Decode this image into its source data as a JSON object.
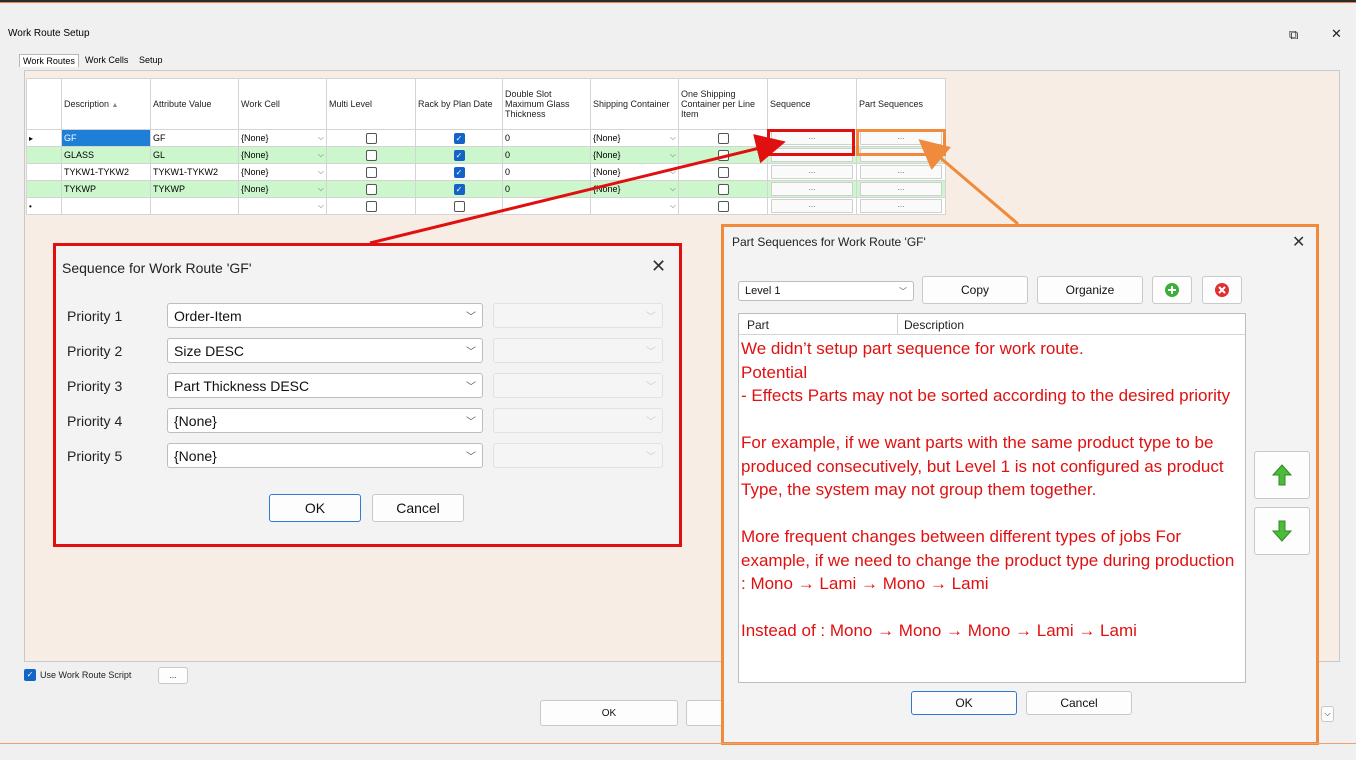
{
  "window": {
    "title": "Work Route Setup",
    "restore_glyph": "⧉",
    "close_glyph": "✕"
  },
  "tabs": [
    "Work Routes",
    "Work Cells",
    "Setup"
  ],
  "grid": {
    "headers": [
      "Description",
      "Attribute Value",
      "Work Cell",
      "Multi Level",
      "Rack by Plan Date",
      "Double Slot Maximum Glass Thickness",
      "Shipping Container",
      "One Shipping Container per Line Item",
      "Sequence",
      "Part Sequences"
    ],
    "rows": [
      {
        "desc": "GF",
        "attr": "GF",
        "cell": "{None}",
        "multi": false,
        "rack": true,
        "dbl": "0",
        "ship": "{None}",
        "one": false
      },
      {
        "desc": "GLASS",
        "attr": "GL",
        "cell": "{None}",
        "multi": false,
        "rack": true,
        "dbl": "0",
        "ship": "{None}",
        "one": false
      },
      {
        "desc": "TYKW1-TYKW2",
        "attr": "TYKW1-TYKW2",
        "cell": "{None}",
        "multi": false,
        "rack": true,
        "dbl": "0",
        "ship": "{None}",
        "one": false
      },
      {
        "desc": "TYKWP",
        "attr": "TYKWP",
        "cell": "{None}",
        "multi": false,
        "rack": true,
        "dbl": "0",
        "ship": "{None}",
        "one": false
      }
    ],
    "ellipsis": "...",
    "current_row_marker": "▸",
    "new_row_marker": "•"
  },
  "bottom": {
    "use_script_label": "Use Work Route Script",
    "script_btn": "...",
    "ok": "OK"
  },
  "sequence_dialog": {
    "title": "Sequence for Work Route 'GF'",
    "priorities": [
      {
        "label": "Priority 1",
        "value": "Order-Item"
      },
      {
        "label": "Priority 2",
        "value": "Size DESC"
      },
      {
        "label": "Priority 3",
        "value": "Part Thickness DESC"
      },
      {
        "label": "Priority 4",
        "value": "{None}"
      },
      {
        "label": "Priority 5",
        "value": "{None}"
      }
    ],
    "ok": "OK",
    "cancel": "Cancel"
  },
  "part_dialog": {
    "title": "Part Sequences for Work Route 'GF'",
    "level": "Level 1",
    "copy": "Copy",
    "organize": "Organize",
    "col_part": "Part",
    "col_desc": "Description",
    "note": "We didn’t setup part sequence for work route.\nPotential\n- Effects Parts may not be sorted according to the desired priority\n\nFor example, if we want parts with the same product type to be produced consecutively, but Level 1 is not configured as product Type, the system may not group them together.\n\nMore frequent changes between different types of jobs For example, if we need to change the product type during production : Mono → Lami → Mono → Lami\n\nInstead of : Mono → Mono → Mono → Lami → Lami",
    "ok": "OK",
    "cancel": "Cancel"
  },
  "colors": {
    "red": "#e01010",
    "orange": "#f08a3c",
    "green_row": "#ccf7cc",
    "selection": "#1e7fd6"
  }
}
